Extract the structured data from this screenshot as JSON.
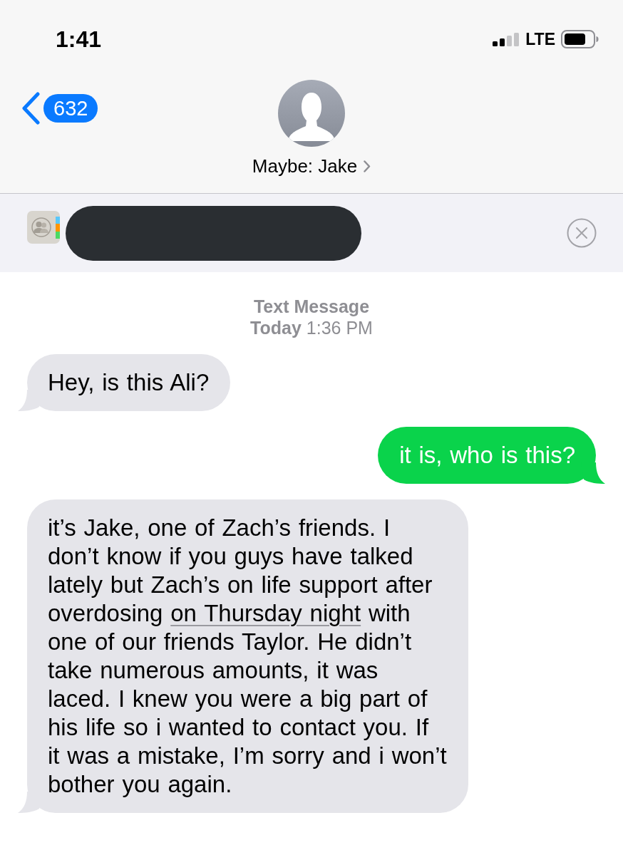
{
  "status_bar": {
    "time": "1:41",
    "network": "LTE"
  },
  "header": {
    "back_badge": "632",
    "contact_name": "Maybe: Jake"
  },
  "banner": {
    "redacted": true
  },
  "timestamp": {
    "title": "Text Message",
    "time": "**Today** 1:36 PM"
  },
  "messages": [
    {
      "kind": "incoming",
      "parts": [
        {
          "kind": "plain",
          "text": "Hey, is this Ali?"
        }
      ]
    },
    {
      "kind": "outgoing",
      "parts": [
        {
          "kind": "plain",
          "text": "it is, who is this?"
        }
      ]
    },
    {
      "kind": "incoming",
      "parts": [
        {
          "kind": "plain",
          "text": "it’s Jake, one of Zach’s friends. I don’t know if you guys have talked lately but Zach’s on life support after overdosing "
        },
        {
          "kind": "link",
          "text": "on Thursday night"
        },
        {
          "kind": "plain",
          "text": " with one of our friends Taylor. He didn’t take numerous amounts, it was laced. I knew you were a big part of his life so i wanted to contact you. If it was a mistake, I’m sorry and i won’t bother you again."
        }
      ]
    }
  ]
}
